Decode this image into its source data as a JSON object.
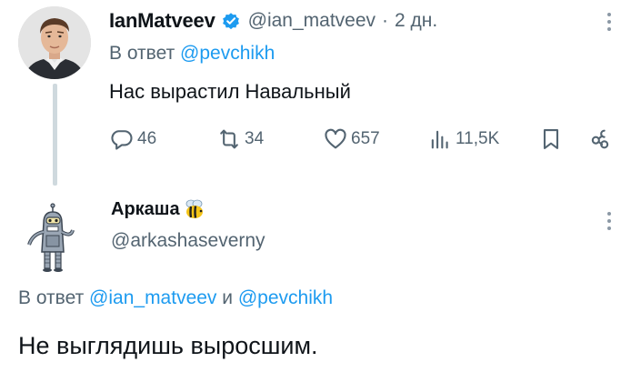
{
  "tweet1": {
    "author": {
      "name": "IanMatveev",
      "handle": "@ian_matveev",
      "separator": "·",
      "time": "2 дн.",
      "verified": true
    },
    "reply_prefix": "В ответ",
    "reply_mentions": [
      "@pevchikh"
    ],
    "text": "Нас вырастил Навальный",
    "stats": {
      "replies": "46",
      "retweets": "34",
      "likes": "657",
      "views": "11,5K"
    },
    "icons": [
      "reply-icon",
      "retweet-icon",
      "like-icon",
      "views-icon",
      "bookmark-icon",
      "share-icon",
      "more-icon"
    ]
  },
  "tweet2": {
    "author": {
      "name": "Аркаша",
      "handle": "@arkashaseverny",
      "name_emoji": "bee-icon"
    },
    "reply_prefix": "В ответ",
    "reply_mentions": [
      "@ian_matveev",
      "@pevchikh"
    ],
    "reply_conjunction": "и",
    "text": "Не выглядишь выросшим.",
    "icons": [
      "more-icon"
    ]
  },
  "colors": {
    "text_primary": "#0f1419",
    "text_secondary": "#536471",
    "link": "#1d9bf0",
    "verified": "#1d9bf0",
    "thread_line": "#cfd9de"
  }
}
